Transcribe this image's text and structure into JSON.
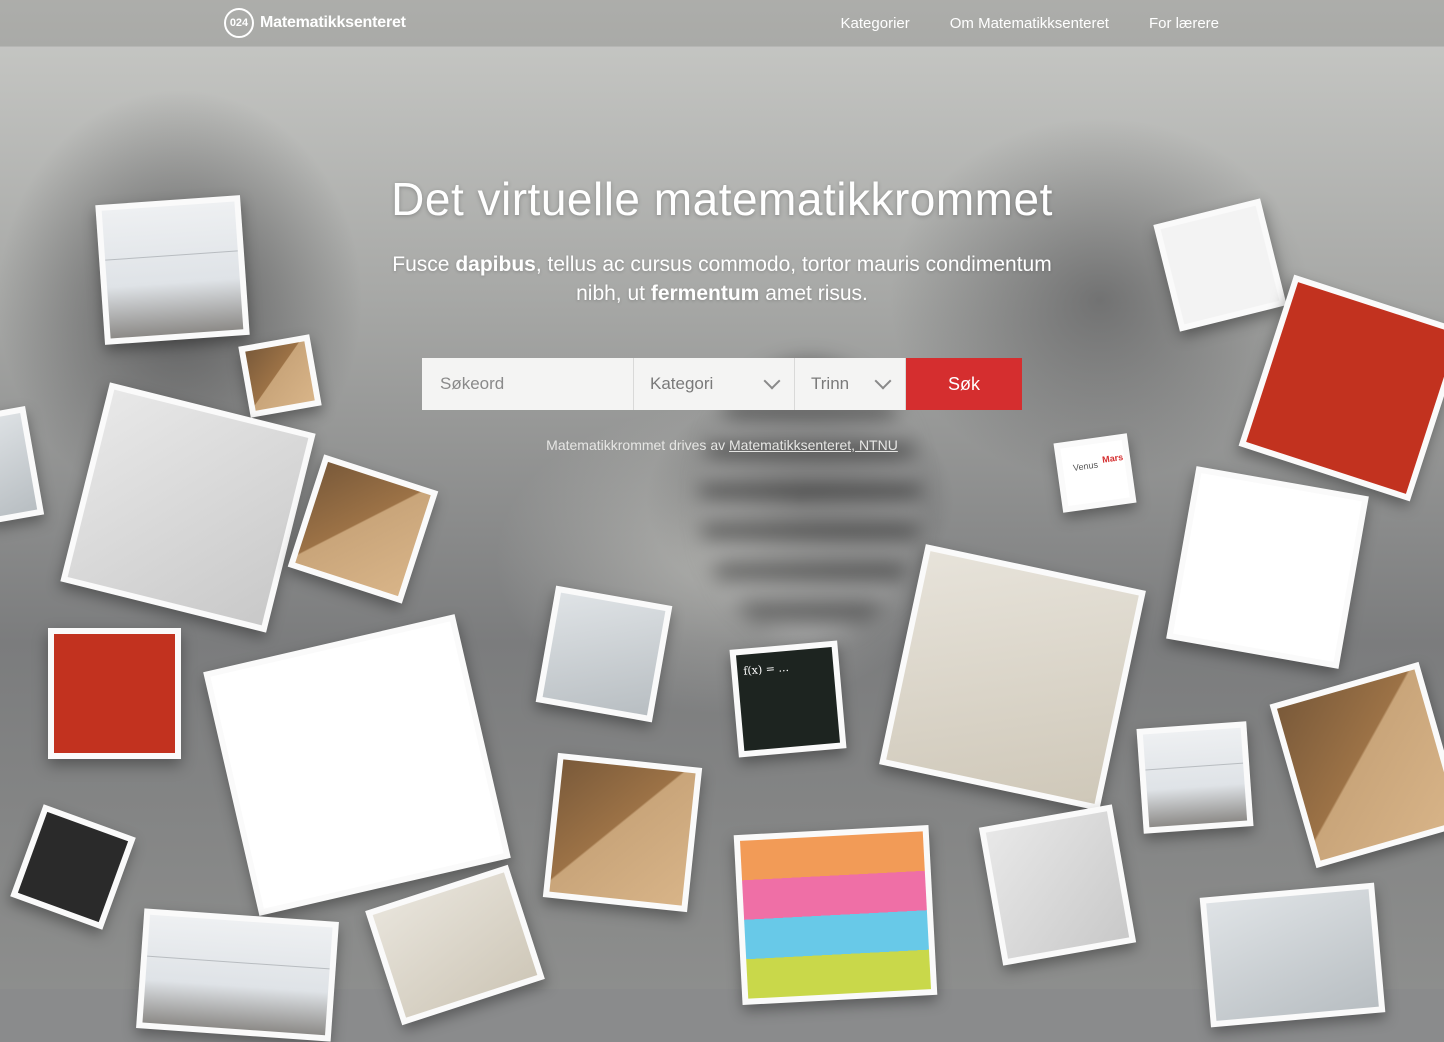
{
  "header": {
    "logo_mark": "024",
    "logo_text": "Matematikksenteret",
    "nav": [
      "Kategorier",
      "Om Matematikksenteret",
      "For lærere"
    ]
  },
  "hero": {
    "title": "Det virtuelle matematikkrommet",
    "subtitle_parts": [
      "Fusce ",
      "dapibus",
      ", tellus ac cursus commodo, tortor mauris condimentum nibh, ut ",
      "fermentum",
      " amet risus."
    ]
  },
  "search": {
    "keyword_placeholder": "Søkeord",
    "category_label": "Kategori",
    "level_label": "Trinn",
    "button_label": "Søk"
  },
  "credit": {
    "text": "Matematikkrommet drives av ",
    "link": "Matematikksenteret, NTNU"
  },
  "decor": {
    "venus_label": "Venus",
    "mars_label": "Mars",
    "formula_text": "f(x) = ..."
  }
}
